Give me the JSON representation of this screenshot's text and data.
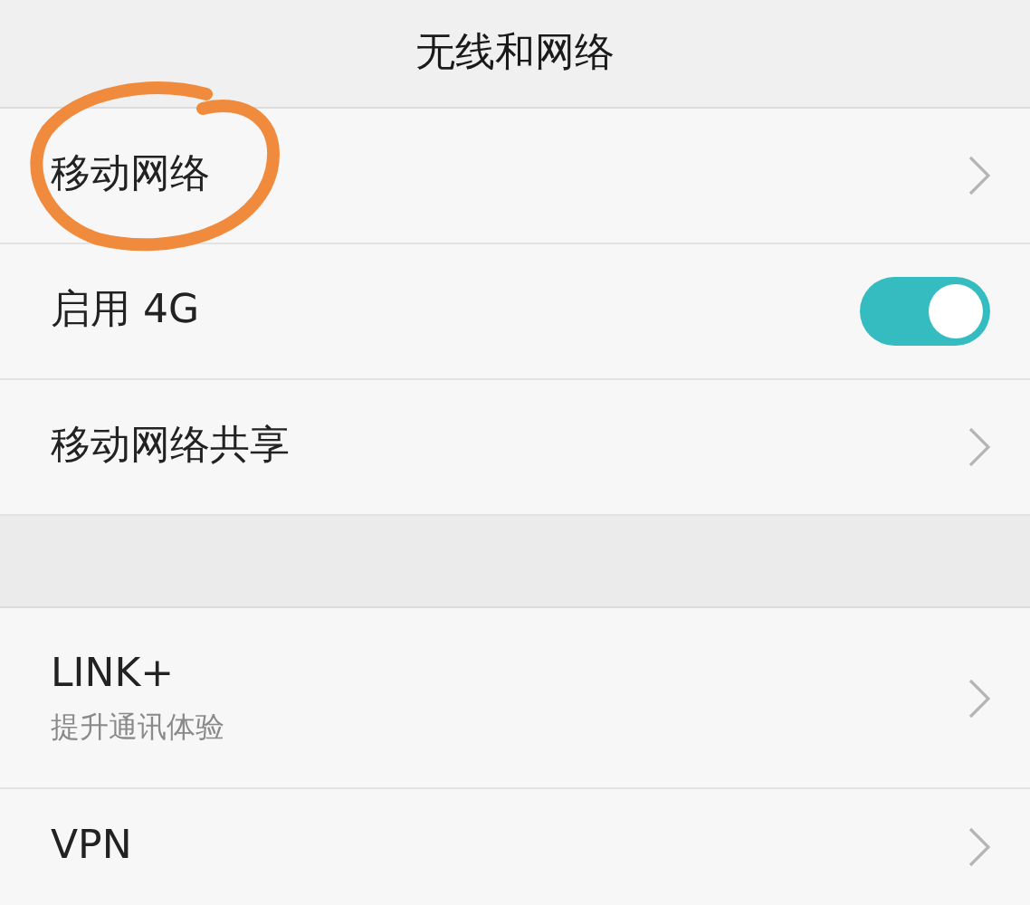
{
  "header": {
    "title": "无线和网络"
  },
  "sections": [
    {
      "items": [
        {
          "kind": "link",
          "label": "移动网络",
          "circled": true
        },
        {
          "kind": "toggle",
          "label": "启用 4G",
          "on": true
        },
        {
          "kind": "link",
          "label": "移动网络共享"
        }
      ]
    },
    {
      "items": [
        {
          "kind": "link",
          "label": "LINK+",
          "subtitle": "提升通讯体验"
        },
        {
          "kind": "link",
          "label": "VPN"
        }
      ]
    }
  ]
}
